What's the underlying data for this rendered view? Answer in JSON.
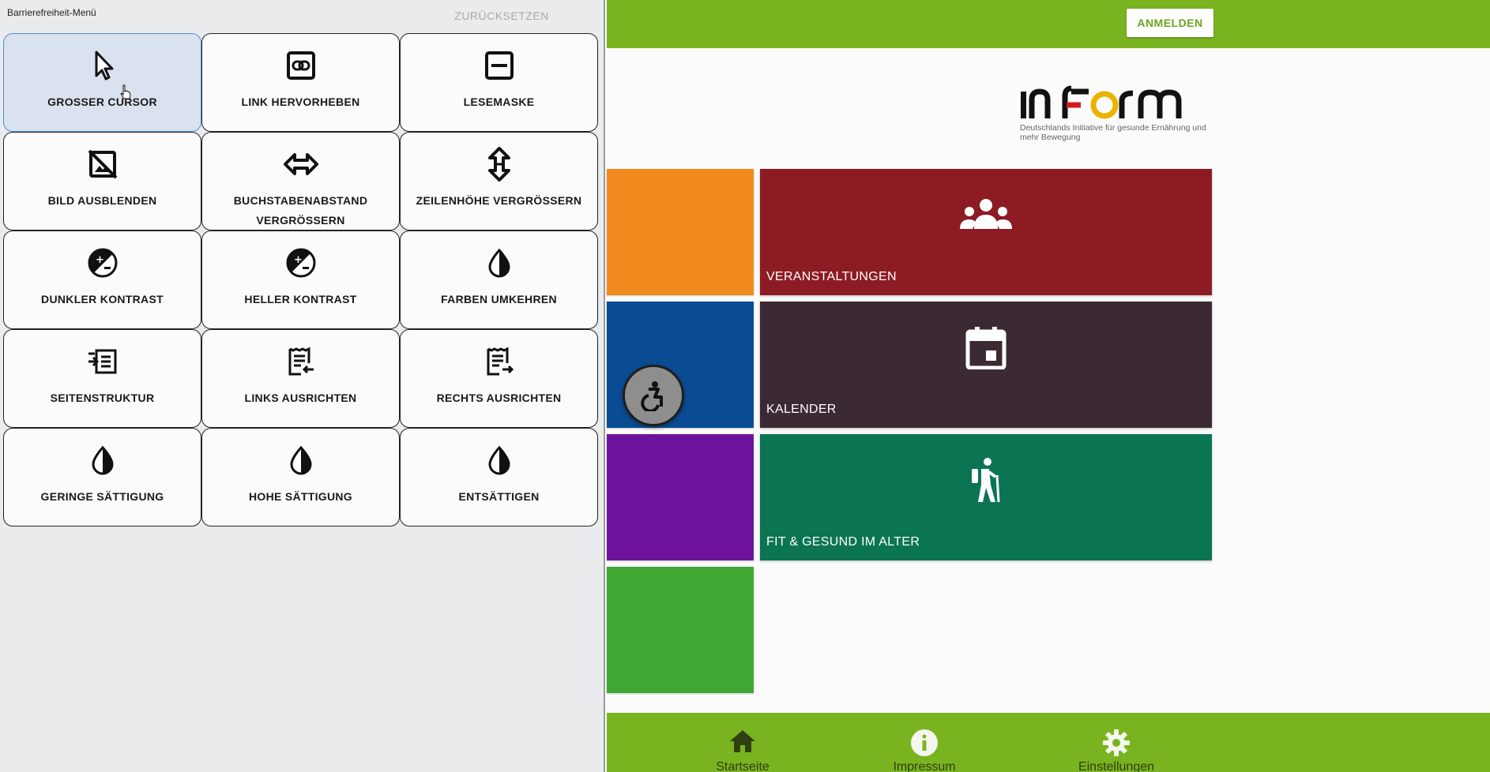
{
  "panel": {
    "title": "Barrierefreiheit-Menü",
    "reset_label": "ZURÜCKSETZEN",
    "tiles": [
      {
        "label": "GROSSER CURSOR",
        "icon": "cursor-arrow-icon",
        "active": true
      },
      {
        "label": "LINK HERVORHEBEN",
        "icon": "link-icon"
      },
      {
        "label": "LESEMASKE",
        "icon": "reading-mask-icon"
      },
      {
        "label": "BILD AUSBLENDEN",
        "icon": "hide-image-icon"
      },
      {
        "label": "BUCHSTABENABSTAND VERGRÖSSERN",
        "icon": "horizontal-arrows-icon"
      },
      {
        "label": "ZEILENHÖHE VERGRÖSSERN",
        "icon": "vertical-arrows-icon"
      },
      {
        "label": "DUNKLER KONTRAST",
        "icon": "contrast-icon"
      },
      {
        "label": "HELLER KONTRAST",
        "icon": "contrast-icon"
      },
      {
        "label": "FARBEN UMKEHREN",
        "icon": "drop-icon"
      },
      {
        "label": "SEITENSTRUKTUR",
        "icon": "page-structure-icon"
      },
      {
        "label": "LINKS AUSRICHTEN",
        "icon": "align-left-icon"
      },
      {
        "label": "RECHTS AUSRICHTEN",
        "icon": "align-right-icon"
      },
      {
        "label": "GERINGE SÄTTIGUNG",
        "icon": "drop-icon"
      },
      {
        "label": "HOHE SÄTTIGUNG",
        "icon": "drop-icon"
      },
      {
        "label": "ENTSÄTTIGEN",
        "icon": "drop-icon"
      }
    ]
  },
  "app": {
    "login_label": "ANMELDEN",
    "logo": {
      "wordmark": "IN FORM",
      "subtitle": "Deutschlands Initiative für gesunde Ernährung und mehr Bewegung"
    },
    "colors": {
      "topbar": "#7ab320",
      "orange": "#f08a1e",
      "blue": "#0a4c94",
      "purple": "#6e139e",
      "green": "#3fa732",
      "red": "#8d1b24",
      "plum": "#3b2a33",
      "teal": "#0b7453"
    },
    "tiles": [
      {
        "label": "VERANSTALTUNGEN",
        "icon": "group-icon",
        "color": "#8d1b24"
      },
      {
        "label": "KALENDER",
        "icon": "calendar-icon",
        "color": "#3b2a33"
      },
      {
        "label": "FIT & GESUND IM ALTER",
        "icon": "hiker-icon",
        "color": "#0b7453"
      }
    ],
    "nav": [
      {
        "label": "Startseite",
        "icon": "home-icon"
      },
      {
        "label": "Impressum",
        "icon": "info-icon"
      },
      {
        "label": "Einstellungen",
        "icon": "gear-icon"
      }
    ]
  }
}
